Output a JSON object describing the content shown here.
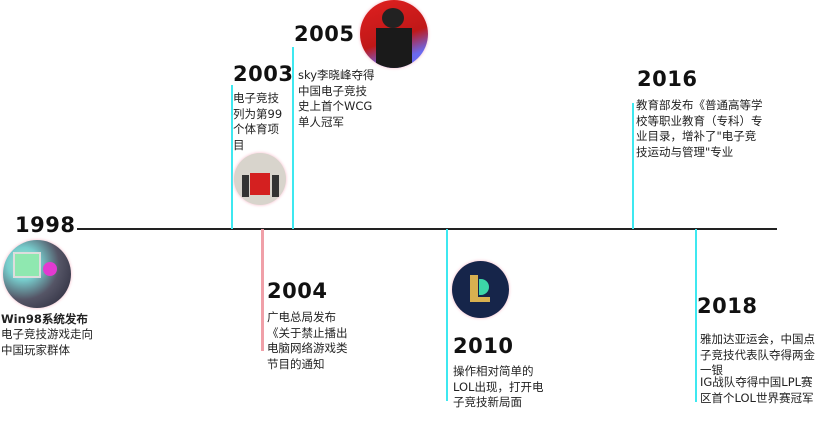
{
  "events": [
    {
      "year": "1998",
      "title": "Win98系统发布",
      "desc": "电子竞技游戏走向中国玩家群体",
      "image": "person-at-computer-photo"
    },
    {
      "year": "2003",
      "desc": "电子竞技列为第99个体育项目",
      "image": "flag-ceremony-photo"
    },
    {
      "year": "2004",
      "desc": "广电总局发布《关于禁止播出电脑网络游戏类节目的通知"
    },
    {
      "year": "2005",
      "desc": "sky李晓峰夺得中国电子竞技史上首个WCG单人冠军",
      "image": "sky-champion-photo"
    },
    {
      "year": "2010",
      "desc": "操作相对简单的LOL出现，打开电子竞技新局面",
      "image": "lol-logo"
    },
    {
      "year": "2016",
      "desc": "教育部发布《普通高等学校等职业教育（专科）专业目录，增补了\"电子竞技运动与管理\"专业"
    },
    {
      "year": "2018",
      "desc": "雅加达亚运会，中国点子竞技代表队夺得两金一银",
      "desc2": "IG战队夺得中国LPL赛区首个LOL世界赛冠军"
    }
  ],
  "colors": {
    "axis": "#222222",
    "connector": "#3ee8f0",
    "connector_2004": "#f0a0a8"
  }
}
